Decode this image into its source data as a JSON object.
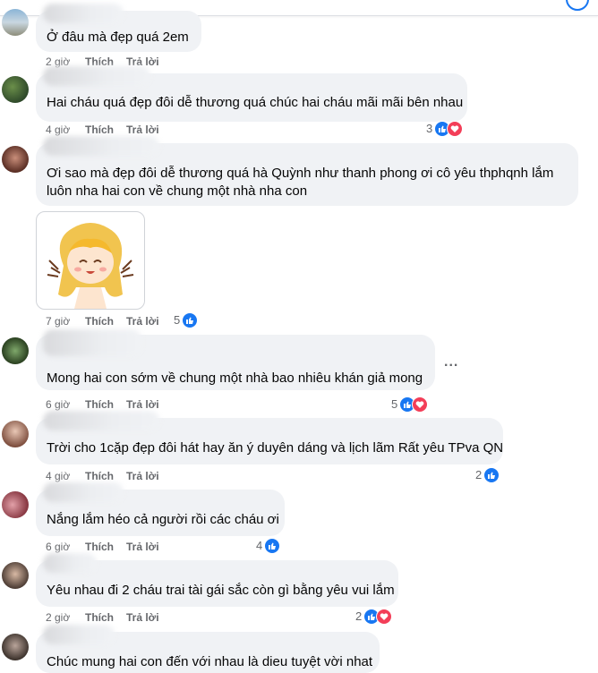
{
  "comments": [
    {
      "text": "Ở đâu mà đẹp quá 2em",
      "time": "2 giờ",
      "like": "Thích",
      "reply": "Trả lời",
      "reactions": "",
      "reaction_types": []
    },
    {
      "text": "Hai cháu quá đẹp đôi dễ thương quá chúc hai cháu mãi mãi bên nhau",
      "time": "4 giờ",
      "like": "Thích",
      "reply": "Trả lời",
      "reactions": "3",
      "reaction_types": [
        "like-icon",
        "love-icon"
      ]
    },
    {
      "text_line1": "Ơi sao mà đẹp đôi dễ thương quá hà Quỳnh như thanh phong ơi cô yêu thphqnh lắm",
      "text_line2": "luôn nha hai con về chung một nhà nha con",
      "time": "7 giờ",
      "like": "Thích",
      "reply": "Trả lời",
      "reactions": "5",
      "reaction_types": [
        "like-icon"
      ]
    },
    {
      "text": "Mong hai con sớm về chung một nhà bao nhiêu khán giả mong",
      "time": "6 giờ",
      "like": "Thích",
      "reply": "Trả lời",
      "reactions": "5",
      "reaction_types": [
        "like-icon",
        "love-icon"
      ],
      "more": "..."
    },
    {
      "text": "Trời cho 1cặp đẹp đôi hát hay ăn ý duyên dáng và lịch lãm Rất yêu TPva QN",
      "time": "4 giờ",
      "like": "Thích",
      "reply": "Trả lời",
      "reactions": "2",
      "reaction_types": [
        "like-icon"
      ]
    },
    {
      "text": "Nắng lắm héo cả người rồi các cháu ơi",
      "time": "6 giờ",
      "like": "Thích",
      "reply": "Trả lời",
      "reactions": "4",
      "reaction_types": [
        "like-icon"
      ]
    },
    {
      "text": "Yêu nhau đi 2 cháu trai tài gái sắc còn gì bằng yêu vui lắm",
      "time": "2 giờ",
      "like": "Thích",
      "reply": "Trả lời",
      "reactions": "2",
      "reaction_types": [
        "like-icon",
        "love-icon"
      ]
    },
    {
      "text": "Chúc mung hai con đến với nhau là dieu tuyệt vời nhat"
    }
  ],
  "colors": {
    "like": "#1877f2",
    "love": "#f33e58",
    "bubble": "#f0f2f5",
    "meta": "#65676b"
  }
}
